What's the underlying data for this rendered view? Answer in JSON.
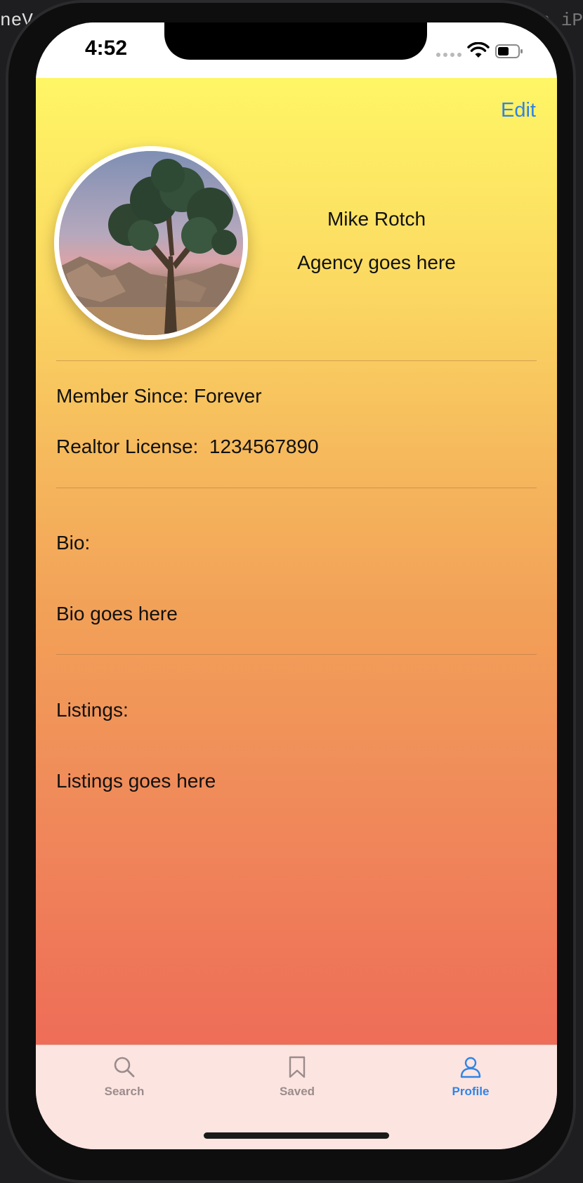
{
  "background": {
    "left_fragment": "neV",
    "right_fragment": "on iP"
  },
  "status_bar": {
    "time": "4:52"
  },
  "header": {
    "edit_label": "Edit"
  },
  "profile": {
    "name": "Mike Rotch",
    "agency": "Agency goes here",
    "member_since": "Member Since: Forever",
    "license": "Realtor License:  1234567890",
    "bio_heading": "Bio:",
    "bio_text": "Bio goes here",
    "listings_heading": "Listings:",
    "listings_text": "Listings goes here"
  },
  "tab_bar": {
    "tabs": [
      {
        "label": "Search",
        "icon": "search-icon",
        "active": false
      },
      {
        "label": "Saved",
        "icon": "bookmark-icon",
        "active": false
      },
      {
        "label": "Profile",
        "icon": "person-icon",
        "active": true
      }
    ]
  },
  "colors": {
    "accent": "#2f84e6",
    "inactive_tab": "#9b8c8c",
    "gradient_top": "#fff665",
    "gradient_bottom": "#ee6d58",
    "tab_bar_bg": "#fce4e0"
  }
}
